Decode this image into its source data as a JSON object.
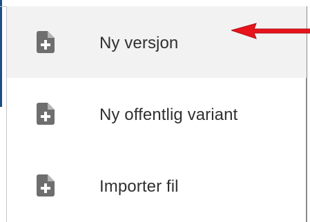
{
  "menu": {
    "items": [
      {
        "label": "Ny versjon",
        "icon": "file-add-icon",
        "highlighted": true
      },
      {
        "label": "Ny offentlig variant",
        "icon": "file-add-icon",
        "highlighted": false
      },
      {
        "label": "Importer fil",
        "icon": "file-add-icon",
        "highlighted": false
      }
    ]
  },
  "annotation": {
    "arrow_color": "#e8131b",
    "arrow_points_to": "Ny versjon"
  },
  "colors": {
    "icon": "#6e6e6e",
    "text": "#303030",
    "highlight": "#f2f2f2",
    "accent": "#1c4f86"
  }
}
